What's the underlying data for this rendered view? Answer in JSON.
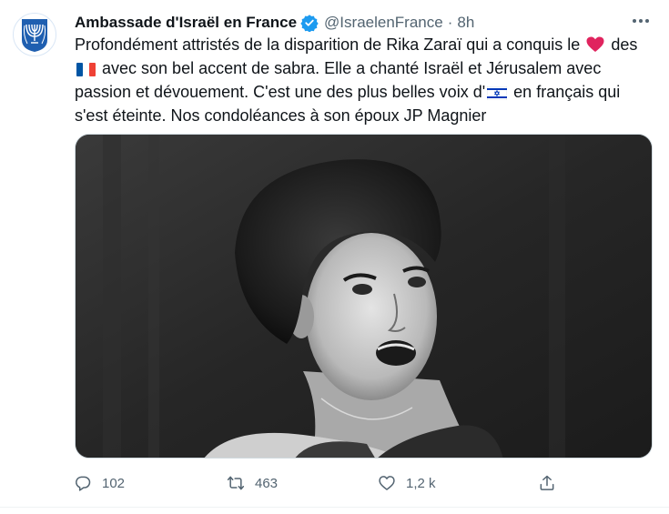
{
  "tweet": {
    "display_name": "Ambassade d'Israël en France",
    "handle": "@IsraelenFrance",
    "separator": "·",
    "time": "8h",
    "text": {
      "part1": "Profondément attristés de la disparition de Rika Zaraï qui a conquis le",
      "part2": "des",
      "part3": "avec son bel accent de sabra. Elle a chanté Israël et Jérusalem avec passion et dévouement. C'est une des plus belles voix d'",
      "part4": "en français qui s'est éteinte. Nos condoléances à son époux JP Magnier"
    },
    "emojis": [
      "red-heart",
      "flag-france",
      "flag-israel"
    ],
    "media": {
      "type": "photo",
      "style": "black-and-white"
    }
  },
  "actions": {
    "reply_count": "102",
    "retweet_count": "463",
    "like_count": "1,2 k"
  },
  "colors": {
    "text": "#0f1419",
    "secondary": "#536471",
    "verified": "#1d9bf0",
    "emblem_blue": "#1f5fb0"
  }
}
